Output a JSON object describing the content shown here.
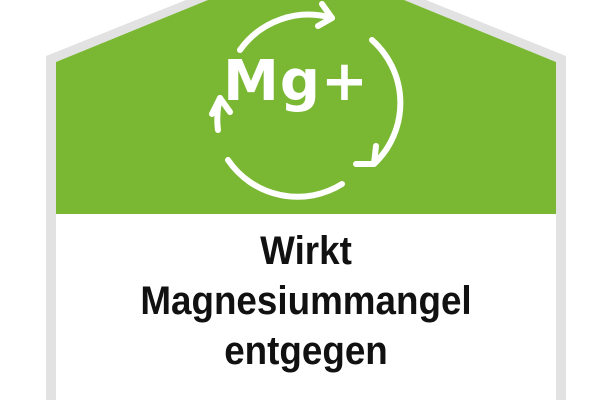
{
  "badge": {
    "symbol": "Mg+",
    "lines": [
      "Wirkt",
      "Magnesiummangel",
      "entgegen"
    ],
    "icon": "recycle-arrows-icon"
  },
  "colors": {
    "green": "#7ab834",
    "border": "#d8d8d8",
    "white": "#ffffff",
    "text": "#111111"
  }
}
